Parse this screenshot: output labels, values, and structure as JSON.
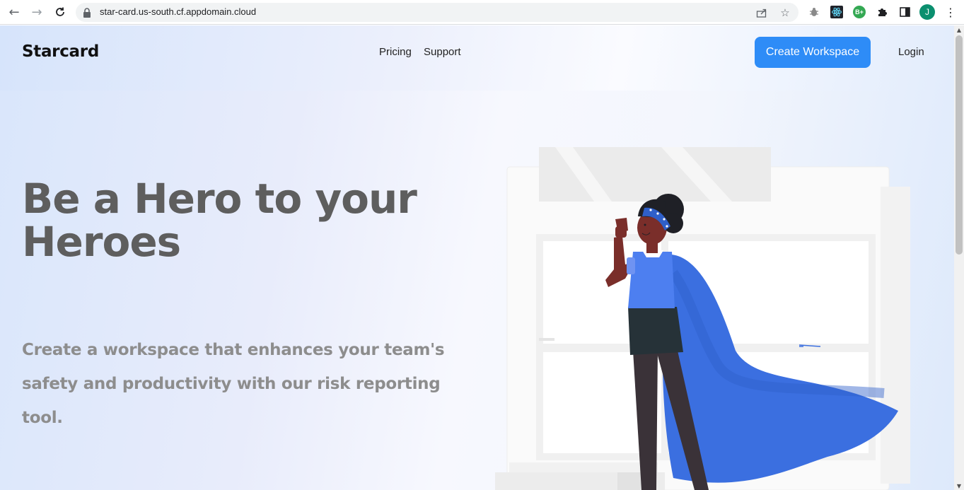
{
  "browser": {
    "url": "star-card.us-south.cf.appdomain.cloud",
    "profile_initial": "J",
    "extensions": [
      "bug-extension",
      "react-devtools",
      "b-plus-extension",
      "extensions-puzzle",
      "side-panel"
    ],
    "ext_badge": "B+"
  },
  "header": {
    "logo": "Starcard",
    "nav": {
      "pricing": "Pricing",
      "support": "Support"
    },
    "cta_label": "Create Workspace",
    "login_label": "Login"
  },
  "hero": {
    "title": "Be a Hero to your Heroes",
    "subtitle": "Create a workspace that enhances your team's safety and productivity with our risk reporting tool."
  },
  "colors": {
    "accent": "#2e8cf7",
    "cape": "#3b6fe0",
    "title": "#5e5e5e",
    "subtitle": "#8d8d8d"
  }
}
